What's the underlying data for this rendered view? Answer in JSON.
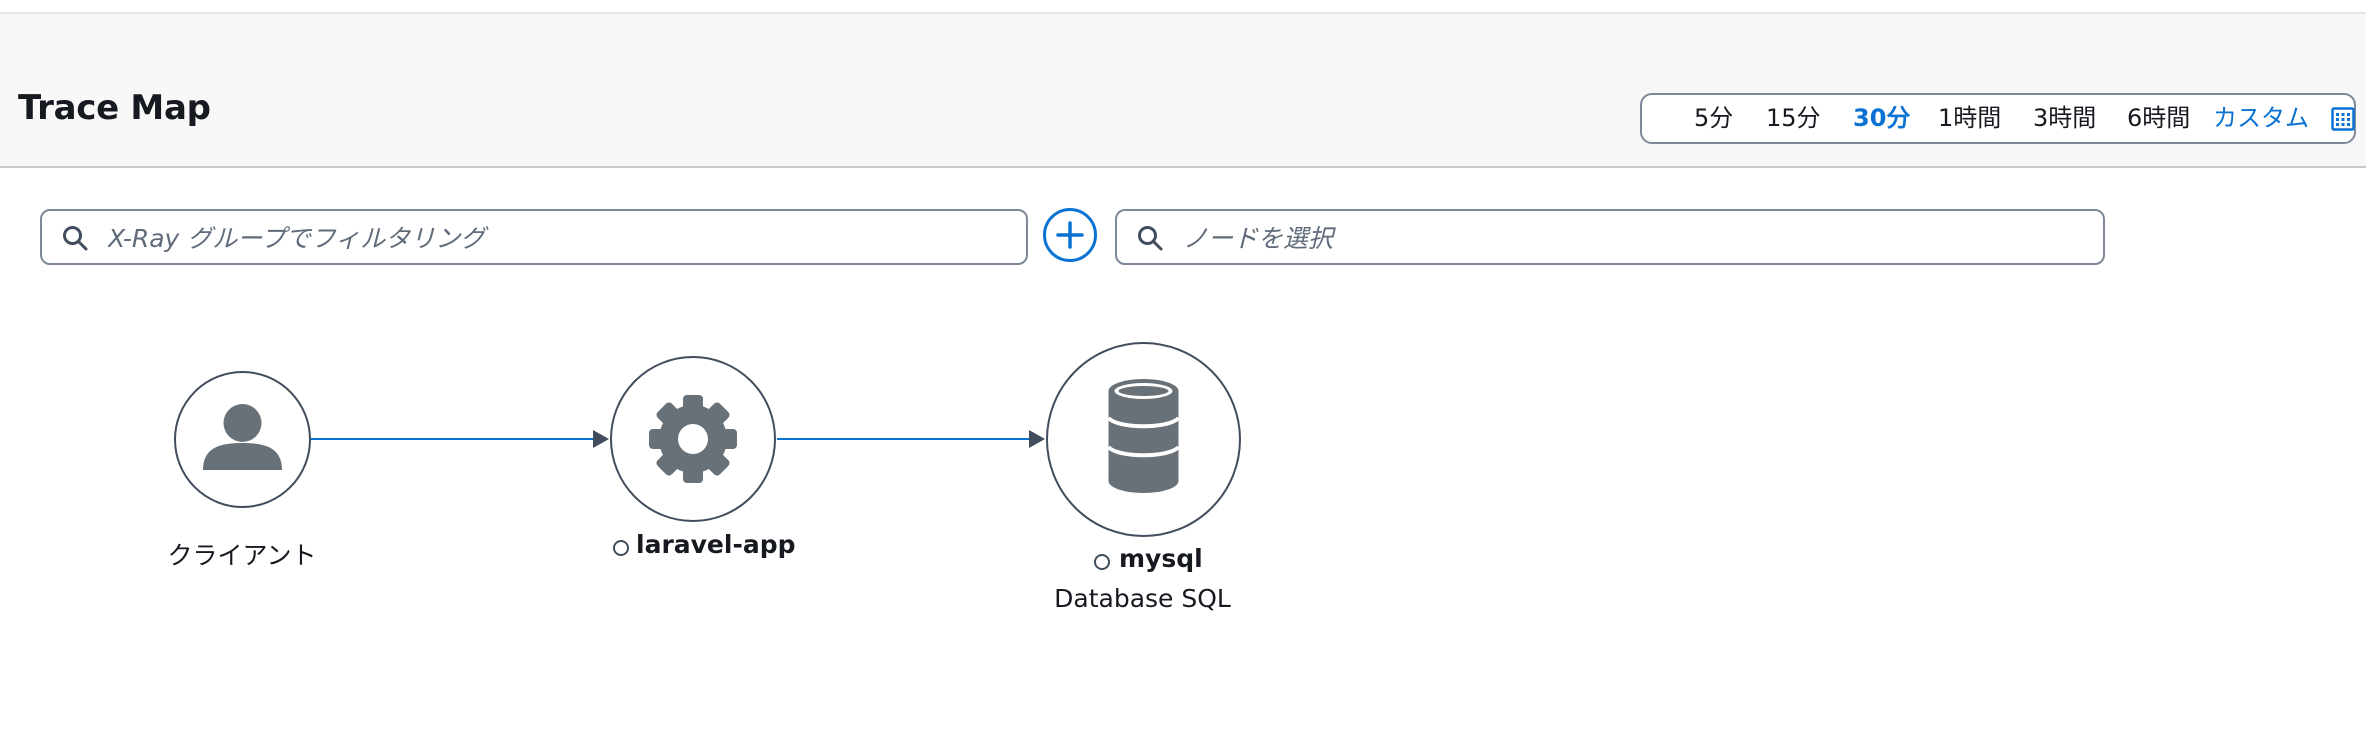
{
  "header": {
    "title": "Trace Map",
    "time_range": {
      "options": [
        "5分",
        "15分",
        "30分",
        "1時間",
        "3時間",
        "6時間"
      ],
      "selected": "30分",
      "custom_label": "カスタム"
    }
  },
  "filters": {
    "group_search": {
      "placeholder": "X-Ray グループでフィルタリング",
      "value": ""
    },
    "node_search": {
      "placeholder": "ノードを選択",
      "value": ""
    }
  },
  "trace_map": {
    "nodes": [
      {
        "id": "client",
        "name": "クライアント",
        "icon": "user-icon"
      },
      {
        "id": "laravel-app",
        "name": "laravel-app",
        "icon": "gear-icon",
        "status": "ok"
      },
      {
        "id": "mysql",
        "name": "mysql",
        "subtitle": "Database SQL",
        "icon": "database-icon",
        "status": "ok"
      }
    ],
    "edges": [
      {
        "from": "client",
        "to": "laravel-app"
      },
      {
        "from": "laravel-app",
        "to": "mysql"
      }
    ]
  },
  "colors": {
    "accent": "#0972d3",
    "node_icon": "#687078",
    "node_border": "#414d5c",
    "header_bg": "#f8f8f8"
  }
}
